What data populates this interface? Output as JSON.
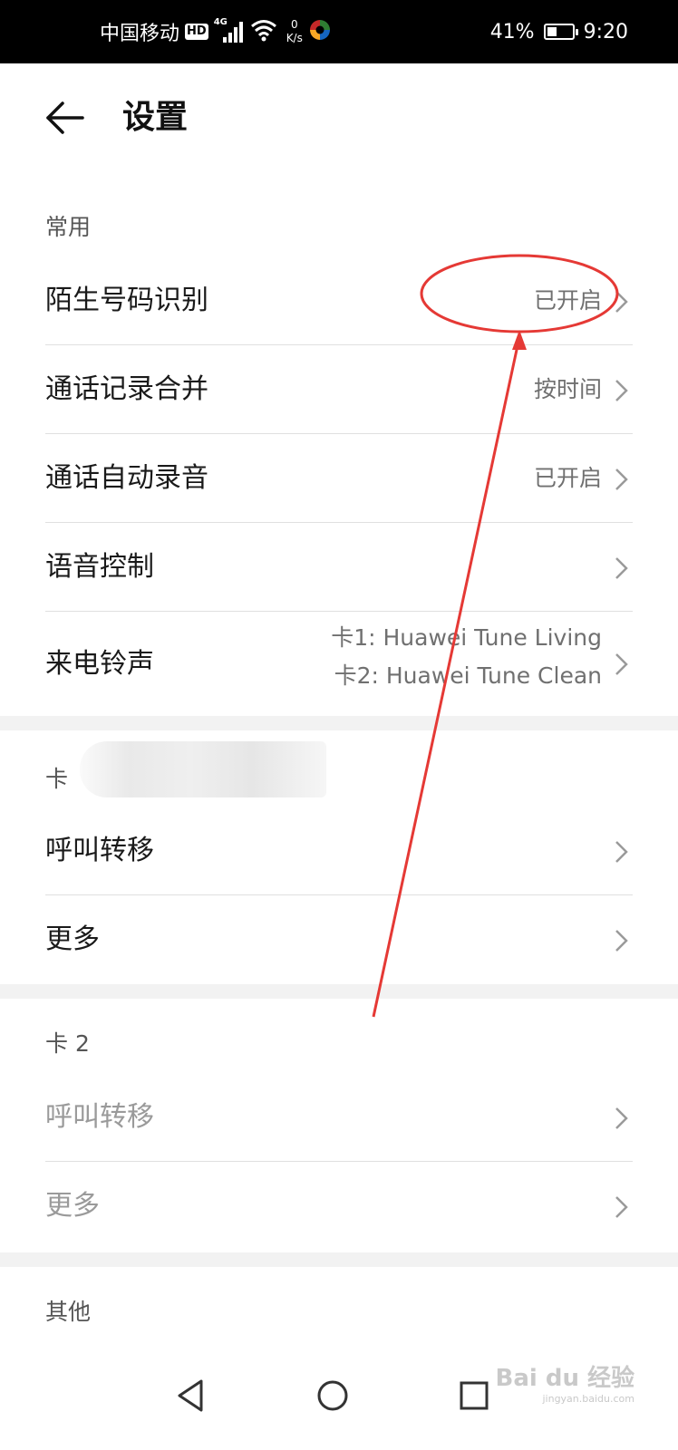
{
  "status_bar": {
    "carrier": "中国移动",
    "hd_badge": "HD",
    "network_type": "4G",
    "speed_value": "0",
    "speed_unit": "K/s",
    "battery_percent": "41%",
    "battery_level": 0.41,
    "time": "9:20",
    "icons": [
      "hd-icon",
      "signal-icon",
      "wifi-icon",
      "app-icon",
      "battery-icon"
    ]
  },
  "header": {
    "title": "设置",
    "back_icon": "back-arrow-icon"
  },
  "sections": {
    "common": {
      "heading": "常用",
      "rows": [
        {
          "label": "陌生号码识别",
          "value": "已开启"
        },
        {
          "label": "通话记录合并",
          "value": "按时间"
        },
        {
          "label": "通话自动录音",
          "value": "已开启"
        },
        {
          "label": "语音控制",
          "value": ""
        },
        {
          "label": "来电铃声",
          "value_line1": "卡1: Huawei Tune Living",
          "value_line2": "卡2: Huawei Tune Clean"
        }
      ]
    },
    "card1": {
      "heading": "卡",
      "rows": [
        {
          "label": "呼叫转移"
        },
        {
          "label": "更多"
        }
      ]
    },
    "card2": {
      "heading": "卡 2",
      "rows": [
        {
          "label": "呼叫转移"
        },
        {
          "label": "更多"
        }
      ]
    },
    "other": {
      "heading": "其他"
    }
  },
  "nav_bar": {
    "icons": [
      "back-triangle-icon",
      "home-circle-icon",
      "recents-square-icon"
    ]
  },
  "watermark": {
    "brand": "Bai du 经验",
    "url": "jingyan.baidu.com"
  },
  "colors": {
    "annotation": "#e53935",
    "secondary_text": "#707070",
    "disabled_text": "#9a9a9a"
  }
}
